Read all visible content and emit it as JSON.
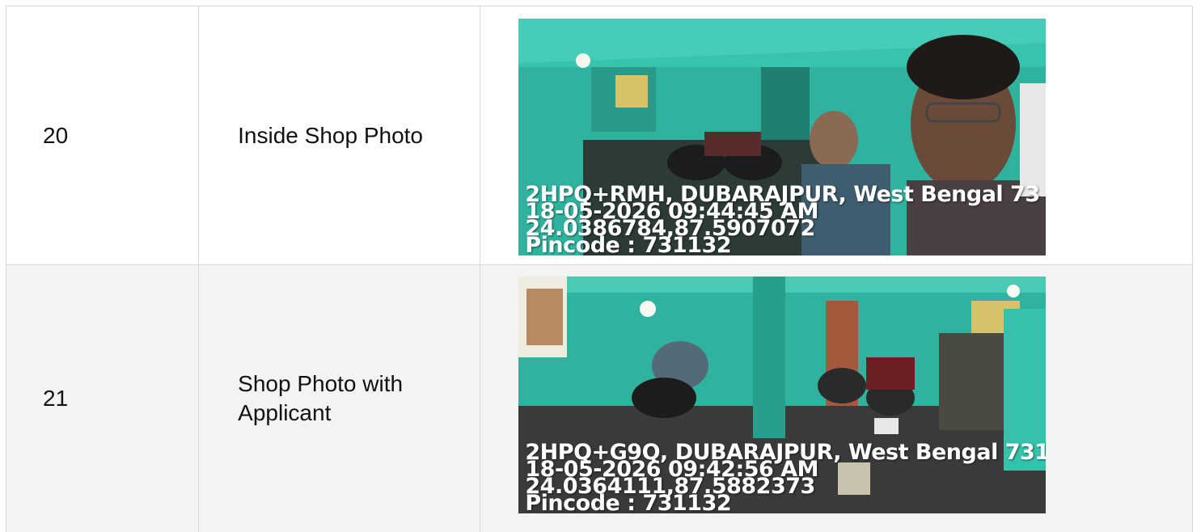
{
  "rows": [
    {
      "number": "20",
      "label": "Inside Shop Photo",
      "photo": {
        "stamp_lines": [
          "2HPQ+RMH, DUBARAJPUR, West Bengal 73",
          "18-05-2026 09:44:45 AM",
          "24.0386784,87.5907072",
          "Pincode : 731132"
        ]
      }
    },
    {
      "number": "21",
      "label_lines": [
        "Shop Photo with",
        "Applicant"
      ],
      "photo": {
        "stamp_lines": [
          "2HPQ+G9Q, DUBARAJPUR, West Bengal 731",
          "18-05-2026 09:42:56 AM",
          "24.0364111,87.5882373",
          "Pincode : 731132"
        ]
      }
    }
  ],
  "colors": {
    "wall_teal": "#2fb39f",
    "floor_dark": "#3a3a38",
    "border": "#d9d9d9",
    "alt_row": "#f3f3f3"
  }
}
